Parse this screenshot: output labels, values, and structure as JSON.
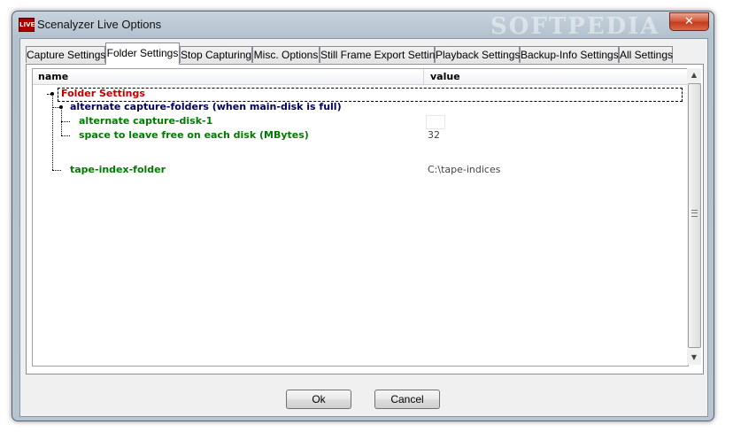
{
  "window": {
    "title": "Scenalyzer Live Options",
    "app_icon_text": "LIVE",
    "watermark": "SOFTPEDIA",
    "close_glyph": "✕"
  },
  "tabs": [
    {
      "label": "Capture Settings",
      "active": false
    },
    {
      "label": "Folder Settings",
      "active": true
    },
    {
      "label": "Stop Capturing",
      "active": false
    },
    {
      "label": "Misc. Options",
      "active": false
    },
    {
      "label": "Still Frame Export Settings",
      "active": false
    },
    {
      "label": "Playback Settings",
      "active": false
    },
    {
      "label": "Backup-Info Settings",
      "active": false
    },
    {
      "label": "All Settings",
      "active": false
    }
  ],
  "tree": {
    "columns": {
      "name": "name",
      "value": "value"
    },
    "rows": [
      {
        "label": "Folder Settings",
        "value": "",
        "color": "#c00000"
      },
      {
        "label": "alternate capture-folders (when main-disk is full)",
        "value": "",
        "color": "#00005a"
      },
      {
        "label": "alternate capture-disk-1",
        "value": "",
        "color": "#007a00"
      },
      {
        "label": "space to leave free on each disk (MBytes)",
        "value": "32",
        "color": "#007a00"
      },
      {
        "label": "tape-index-folder",
        "value": "C:\\tape-indices",
        "color": "#007a00"
      }
    ]
  },
  "buttons": {
    "ok": "Ok",
    "cancel": "Cancel"
  }
}
